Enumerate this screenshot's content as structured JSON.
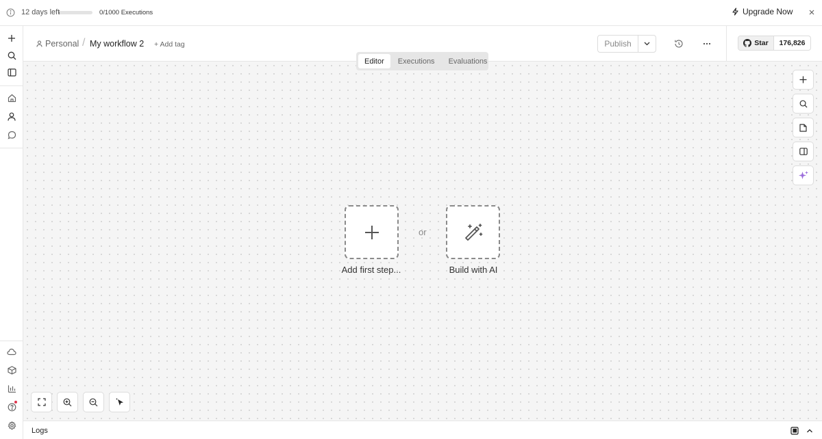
{
  "banner": {
    "days_left": "12 days left",
    "executions": "0/1000 Executions",
    "executions_progress": 0.03,
    "upgrade_label": "Upgrade Now"
  },
  "breadcrumb": {
    "project": "Personal",
    "separator": "/",
    "workflow_name": "My workflow 2",
    "add_tag": "+ Add tag"
  },
  "header": {
    "publish_label": "Publish"
  },
  "github": {
    "star_label": "Star",
    "star_count": "176,826"
  },
  "tabs": [
    {
      "label": "Editor",
      "active": true
    },
    {
      "label": "Executions",
      "active": false
    },
    {
      "label": "Evaluations",
      "active": false
    }
  ],
  "canvas": {
    "add_first_step": "Add first step...",
    "or_label": "or",
    "build_with_ai": "Build with AI"
  },
  "logs": {
    "label": "Logs"
  },
  "colors": {
    "ai_accent": "#9b6ddb",
    "notification_dot": "#e0334c"
  }
}
